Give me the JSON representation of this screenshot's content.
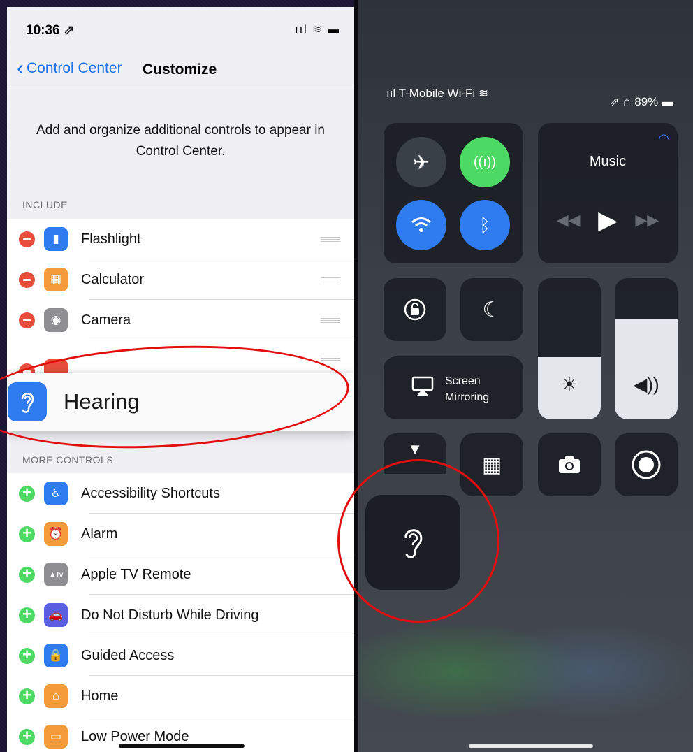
{
  "left": {
    "status": {
      "time": "10:36 ⇗",
      "icons": "ııl ≋ ▬"
    },
    "nav": {
      "back_label": "Control Center",
      "title": "Customize"
    },
    "description": "Add and organize additional controls to appear in Control Center.",
    "include_header": "INCLUDE",
    "include": [
      {
        "label": "Flashlight",
        "color": "#2f7cf0",
        "icon": "flashlight-icon",
        "glyph": "▮"
      },
      {
        "label": "Calculator",
        "color": "#f39a3a",
        "icon": "calculator-icon",
        "glyph": "▦"
      },
      {
        "label": "Camera",
        "color": "#8e8e93",
        "icon": "camera-icon",
        "glyph": "◉"
      }
    ],
    "dragging": {
      "label": "Hearing",
      "color": "#2f7cf0",
      "icon": "ear-icon"
    },
    "more_header": "MORE CONTROLS",
    "more": [
      {
        "label": "Accessibility Shortcuts",
        "color": "#2f7cf0",
        "icon": "accessibility-icon",
        "glyph": "♿"
      },
      {
        "label": "Alarm",
        "color": "#f39a3a",
        "icon": "alarm-icon",
        "glyph": "⏰"
      },
      {
        "label": "Apple TV Remote",
        "color": "#8e8e93",
        "icon": "apple-tv-icon",
        "glyph": "tv"
      },
      {
        "label": "Do Not Disturb While Driving",
        "color": "#5b5ee0",
        "icon": "car-icon",
        "glyph": "🚗"
      },
      {
        "label": "Guided Access",
        "color": "#2f7cf0",
        "icon": "lock-icon",
        "glyph": "🔒"
      },
      {
        "label": "Home",
        "color": "#f39a3a",
        "icon": "home-icon",
        "glyph": "⌂"
      },
      {
        "label": "Low Power Mode",
        "color": "#f39a3a",
        "icon": "battery-icon",
        "glyph": "▭"
      }
    ]
  },
  "right": {
    "status_left": "ııl T-Mobile Wi-Fi ≋",
    "status_right": "⇗ ∩ 89% ▬",
    "music_title": "Music",
    "screen_mirroring": {
      "line1": "Screen",
      "line2": "Mirroring"
    },
    "brightness_level": 0.44,
    "volume_level": 0.71
  }
}
